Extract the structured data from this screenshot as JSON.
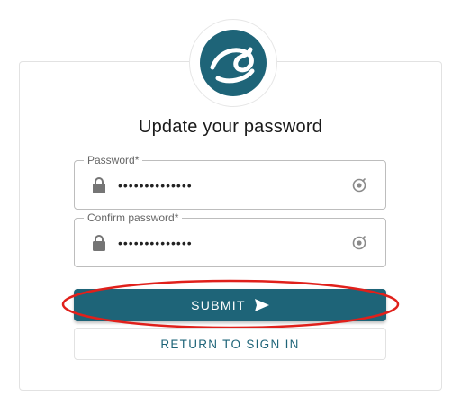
{
  "branding": {
    "logo_icon": "wave-swirl-logo-icon",
    "brand_color": "#1e6478"
  },
  "form": {
    "title": "Update your password",
    "password": {
      "label": "Password*",
      "value": "••••••••••••••",
      "lock_icon": "lock-icon",
      "toggle_icon": "visibility-toggle-icon"
    },
    "confirm_password": {
      "label": "Confirm password*",
      "value": "••••••••••••••",
      "lock_icon": "lock-icon",
      "toggle_icon": "visibility-toggle-icon"
    },
    "submit_label": "SUBMIT",
    "submit_icon": "send-arrow-icon",
    "return_label": "RETURN TO SIGN IN"
  },
  "annotation": {
    "highlight_color": "#e0201b"
  }
}
